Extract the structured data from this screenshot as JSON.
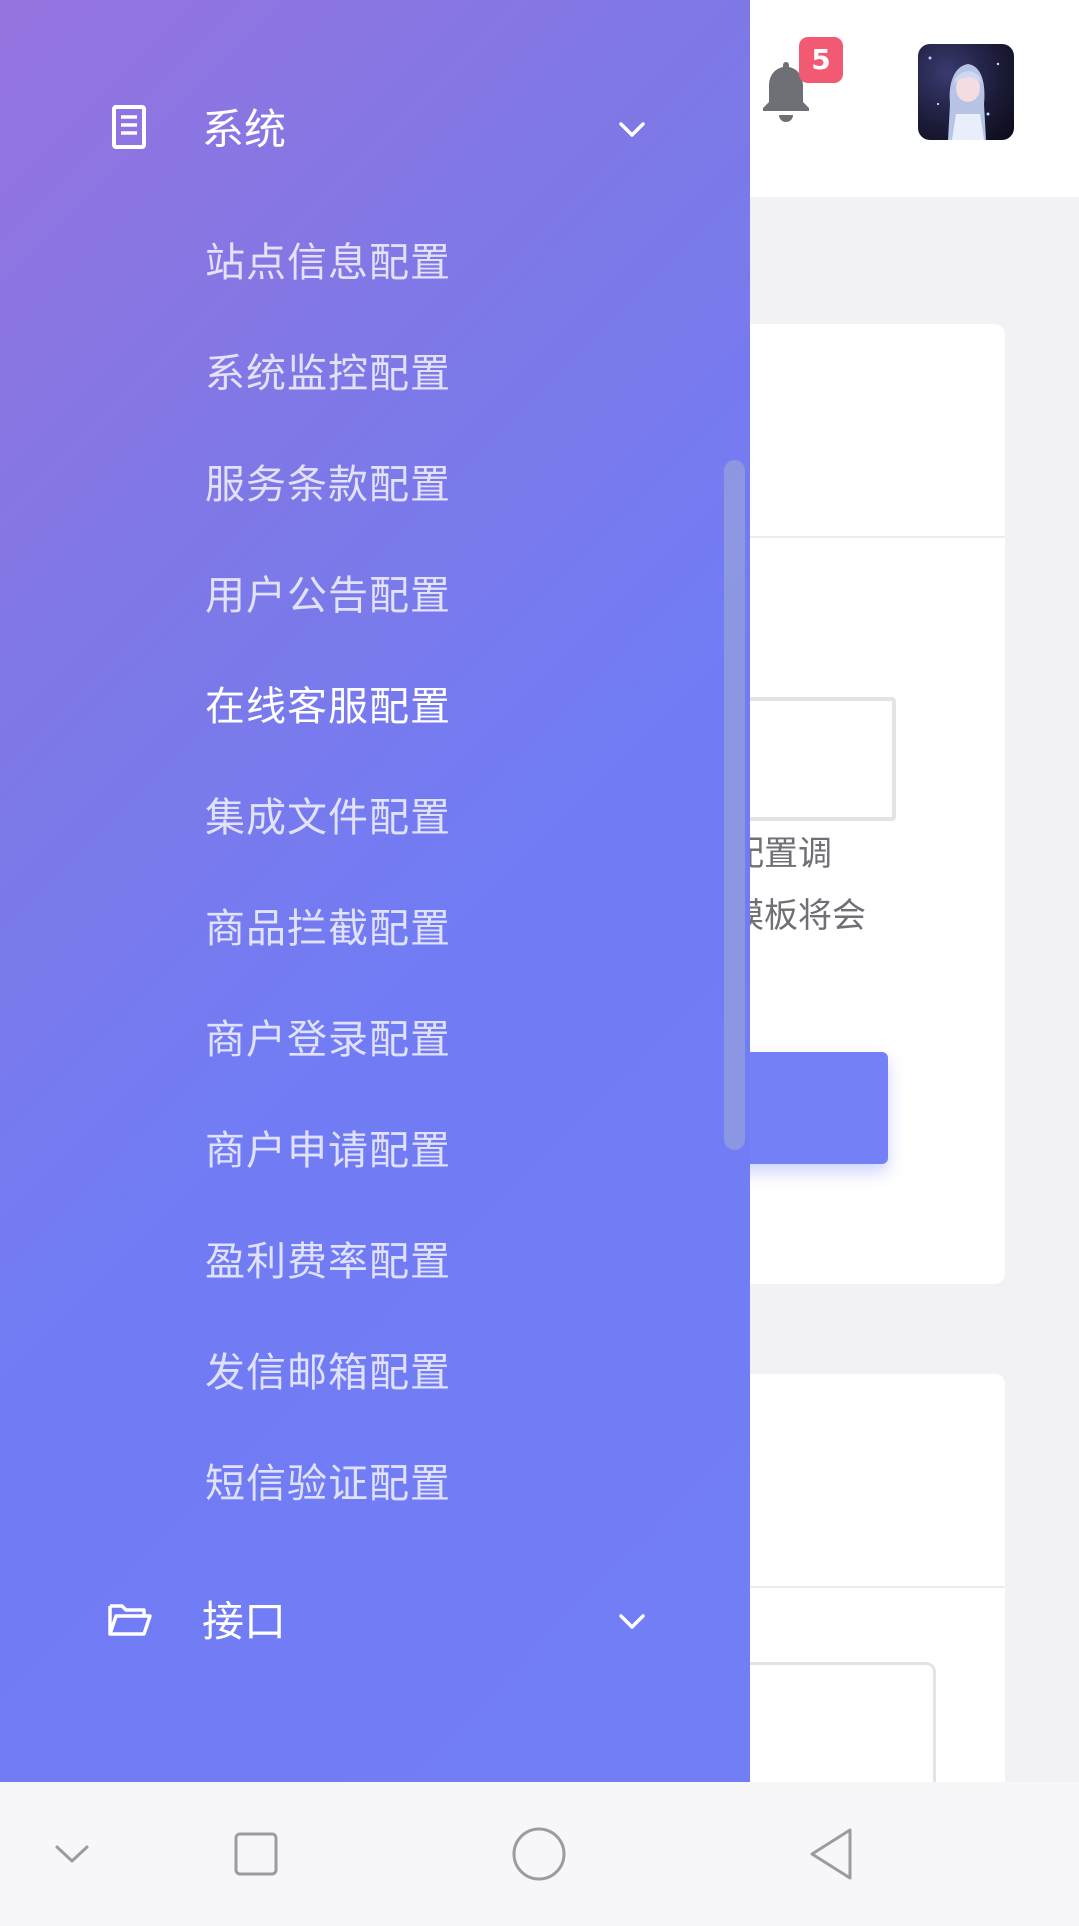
{
  "header": {
    "notification_count": "5",
    "bell_icon": "bell-icon",
    "avatar": "user-avatar"
  },
  "background": {
    "hint_line1": "配置调",
    "hint_line2": "模板将会"
  },
  "drawer": {
    "groups": [
      {
        "label": "系统",
        "icon": "document-icon",
        "expanded": true,
        "items": [
          "站点信息配置",
          "系统监控配置",
          "服务条款配置",
          "用户公告配置",
          "在线客服配置",
          "集成文件配置",
          "商品拦截配置",
          "商户登录配置",
          "商户申请配置",
          "盈利费率配置",
          "发信邮箱配置",
          "短信验证配置"
        ],
        "active_item": "在线客服配置"
      },
      {
        "label": "接口",
        "icon": "folder-icon",
        "expanded": false
      }
    ]
  },
  "nav_bar": {
    "buttons": [
      "hide-keyboard-icon",
      "recents-icon",
      "home-icon",
      "back-icon"
    ]
  },
  "colors": {
    "drawer_gradient_start": "#9673df",
    "drawer_gradient_end": "#727ef6",
    "badge": "#f25a74",
    "primary_button": "#7480f6"
  }
}
